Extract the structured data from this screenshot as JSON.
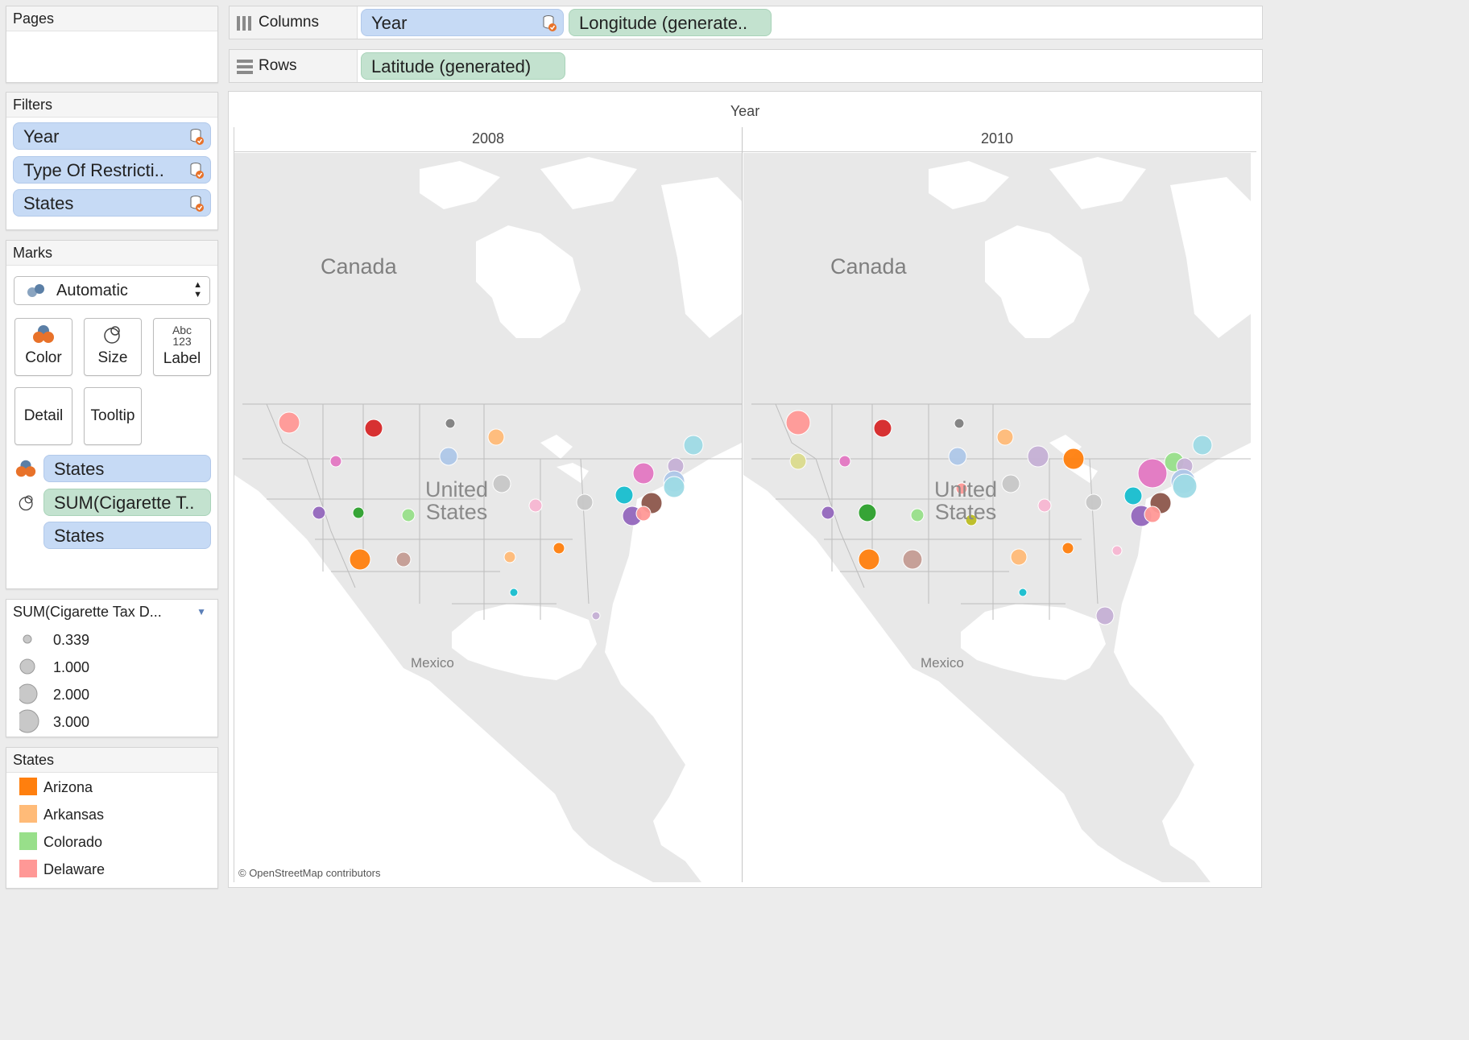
{
  "pages_panel": {
    "title": "Pages"
  },
  "columns_shelf": {
    "label": "Columns",
    "pills": [
      "Year",
      "Longitude (generate.."
    ]
  },
  "rows_shelf": {
    "label": "Rows",
    "pills": [
      "Latitude (generated)"
    ]
  },
  "filters_panel": {
    "title": "Filters",
    "items": [
      "Year",
      "Type Of Restricti..",
      "States"
    ]
  },
  "marks_panel": {
    "title": "Marks",
    "mark_type": "Automatic",
    "buttons": {
      "color": "Color",
      "size": "Size",
      "label": "Label",
      "label_icon_top": "Abc",
      "label_icon_bottom": "123",
      "detail": "Detail",
      "tooltip": "Tooltip"
    },
    "fields": [
      "States",
      "SUM(Cigarette T..",
      "States"
    ]
  },
  "size_legend": {
    "title": "SUM(Cigarette Tax D...",
    "items": [
      "0.339",
      "1.000",
      "2.000",
      "3.000"
    ]
  },
  "states_legend": {
    "title": "States",
    "items": [
      {
        "label": "Arizona",
        "color": "#ff7f0e"
      },
      {
        "label": "Arkansas",
        "color": "#ffbb78"
      },
      {
        "label": "Colorado",
        "color": "#98df8a"
      },
      {
        "label": "Delaware",
        "color": "#ff9896"
      }
    ]
  },
  "viz": {
    "column_header": "Year",
    "panes": [
      {
        "year": "2008",
        "country_labels": {
          "canada": "Canada",
          "us_line1": "United",
          "us_line2": "States",
          "mexico": "Mexico"
        }
      },
      {
        "year": "2010",
        "country_labels": {
          "canada": "Canada",
          "us_line1": "United",
          "us_line2": "States",
          "mexico": "Mexico"
        }
      }
    ],
    "attribution": "© OpenStreetMap contributors"
  },
  "colors": {
    "water": "#ffffff",
    "land": "#e8e8e8",
    "border": "#bdbdbd",
    "pill_blue": "#c6daf5",
    "pill_green": "#c3e2cf"
  }
}
